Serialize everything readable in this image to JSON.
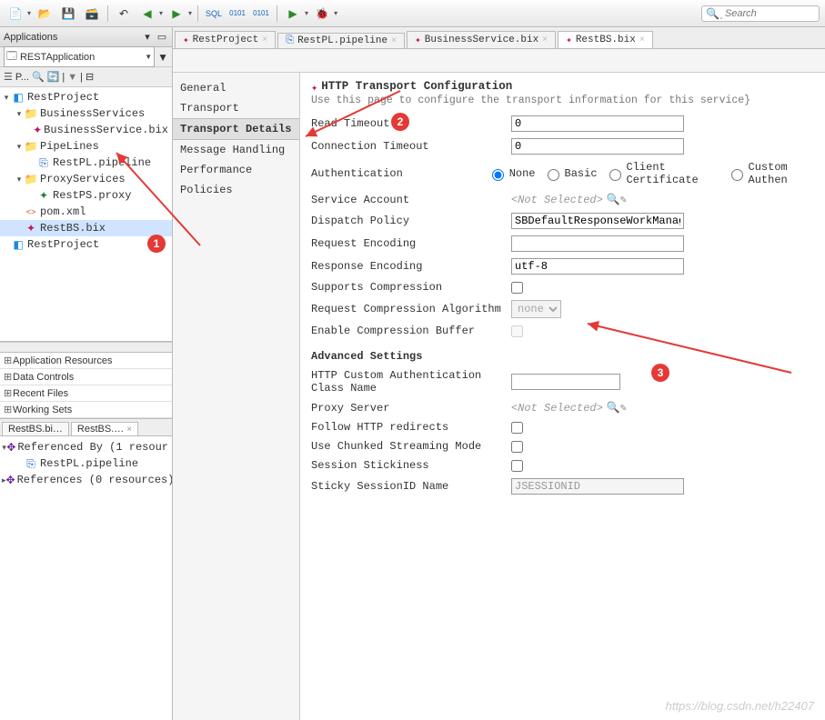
{
  "toolbar": {
    "search_placeholder": "Search"
  },
  "left_panel": {
    "title": "Applications",
    "project_selector": "RESTApplication",
    "filter_prefix": "P...",
    "tree": [
      {
        "indent": 0,
        "twisty": "▾",
        "icon": "cube",
        "label": "RestProject"
      },
      {
        "indent": 1,
        "twisty": "▾",
        "icon": "folder",
        "label": "BusinessServices"
      },
      {
        "indent": 2,
        "twisty": "",
        "icon": "svc-pink",
        "label": "BusinessService.bix"
      },
      {
        "indent": 1,
        "twisty": "▾",
        "icon": "folder",
        "label": "PipeLines"
      },
      {
        "indent": 2,
        "twisty": "",
        "icon": "pipe",
        "label": "RestPL.pipeline"
      },
      {
        "indent": 1,
        "twisty": "▾",
        "icon": "folder",
        "label": "ProxyServices"
      },
      {
        "indent": 2,
        "twisty": "",
        "icon": "svc-green",
        "label": "RestPS.proxy"
      },
      {
        "indent": 1,
        "twisty": "",
        "icon": "xml",
        "label": "pom.xml"
      },
      {
        "indent": 1,
        "twisty": "",
        "icon": "svc-pink",
        "label": "RestBS.bix",
        "selected": true
      },
      {
        "indent": 0,
        "twisty": "",
        "icon": "cube",
        "label": "RestProject"
      }
    ],
    "accordion": [
      "Application Resources",
      "Data Controls",
      "Recent Files",
      "Working Sets"
    ],
    "bottom_tabs": [
      {
        "label": "RestBS.bi…",
        "active": false
      },
      {
        "label": "RestBS.…",
        "active": true
      }
    ],
    "ref_tree": [
      {
        "indent": 0,
        "twisty": "▾",
        "icon": "ref",
        "label": "Referenced By (1 resour"
      },
      {
        "indent": 1,
        "twisty": "",
        "icon": "pipe",
        "label": "RestPL.pipeline"
      },
      {
        "indent": 0,
        "twisty": "▸",
        "icon": "ref",
        "label": "References (0 resources)"
      }
    ]
  },
  "editor": {
    "tabs": [
      {
        "icon": "svc-pink",
        "label": "RestProject",
        "active": false
      },
      {
        "icon": "pipe",
        "label": "RestPL.pipeline",
        "active": false
      },
      {
        "icon": "svc-pink",
        "label": "BusinessService.bix",
        "active": false
      },
      {
        "icon": "svc-pink",
        "label": "RestBS.bix",
        "active": true
      }
    ],
    "nav": [
      "General",
      "Transport",
      "Transport Details",
      "Message Handling",
      "Performance",
      "Policies"
    ],
    "nav_active": "Transport Details",
    "form": {
      "title": "HTTP Transport Configuration",
      "desc": "Use this page to configure the transport information for this service}",
      "read_timeout_label": "Read Timeout",
      "read_timeout": "0",
      "conn_timeout_label": "Connection Timeout",
      "conn_timeout": "0",
      "auth_label": "Authentication",
      "auth_options": [
        "None",
        "Basic",
        "Client Certificate",
        "Custom Authen"
      ],
      "auth_selected": "None",
      "svc_account_label": "Service Account",
      "svc_account_value": "<Not Selected>",
      "dispatch_label": "Dispatch Policy",
      "dispatch_value": "SBDefaultResponseWorkManager",
      "req_enc_label": "Request Encoding",
      "req_enc_value": "",
      "res_enc_label": "Response Encoding",
      "res_enc_value": "utf-8",
      "supports_comp_label": "Supports Compression",
      "req_comp_alg_label": "Request Compression Algorithm",
      "req_comp_alg_value": "none",
      "enable_comp_buf_label": "Enable Compression Buffer",
      "adv_settings": "Advanced Settings",
      "http_auth_class_label": "HTTP Custom Authentication Class Name",
      "http_auth_class_value": "",
      "proxy_server_label": "Proxy Server",
      "proxy_server_value": "<Not Selected>",
      "follow_redir_label": "Follow HTTP redirects",
      "chunked_label": "Use Chunked Streaming Mode",
      "session_stick_label": "Session Stickiness",
      "sticky_id_label": "Sticky SessionID Name",
      "sticky_id_value": "JSESSIONID"
    }
  },
  "annotations": {
    "b1": "1",
    "b2": "2",
    "b3": "3"
  },
  "watermark": "https://blog.csdn.net/h22407"
}
